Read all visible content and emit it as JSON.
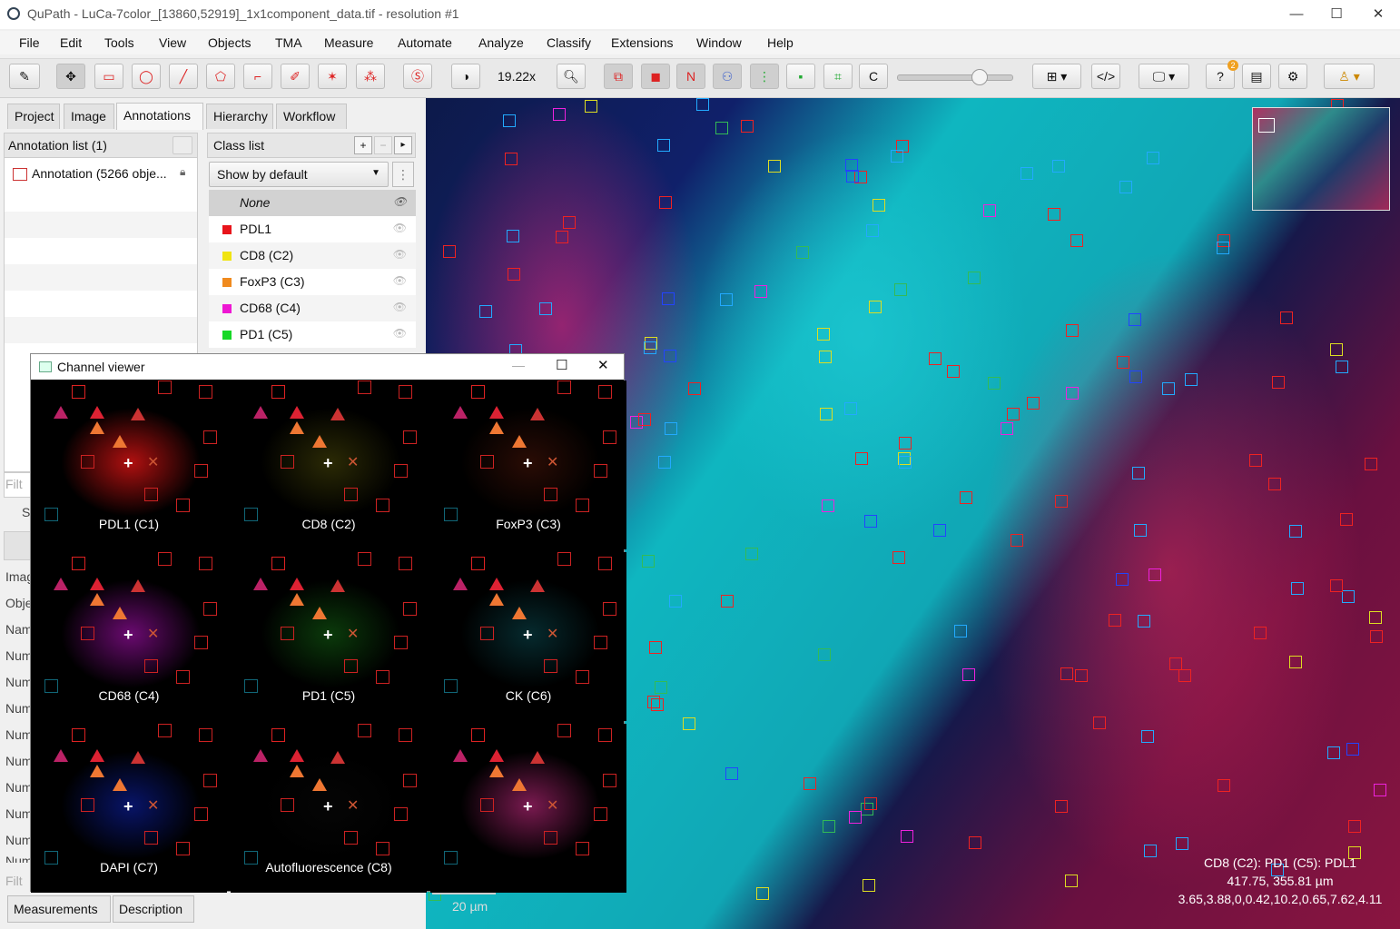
{
  "window": {
    "title": "QuPath - LuCa-7color_[13860,52919]_1x1component_data.tif - resolution #1",
    "controls": [
      "—",
      "☐",
      "✕"
    ]
  },
  "menu": [
    "File",
    "Edit",
    "Tools",
    "View",
    "Objects",
    "TMA",
    "Measure",
    "Automate",
    "Analyze",
    "Classify",
    "Extensions",
    "Window",
    "Help"
  ],
  "toolbar": {
    "zoom": "19.22x",
    "n_label": "N",
    "c_label": "C",
    "badge": "2"
  },
  "left_tabs": [
    "Project",
    "Image",
    "Annotations",
    "Hierarchy",
    "Workflow"
  ],
  "annotation_list": {
    "header": "Annotation list (1)",
    "items": [
      "Annotation (5266 obje..."
    ]
  },
  "class_list": {
    "header": "Class list",
    "show_by_default": "Show by default",
    "classes": [
      {
        "name": "None",
        "color": ""
      },
      {
        "name": "PDL1",
        "color": "#e8141b"
      },
      {
        "name": "CD8 (C2)",
        "color": "#f0e411"
      },
      {
        "name": "FoxP3 (C3)",
        "color": "#f08a1e"
      },
      {
        "name": "CD68 (C4)",
        "color": "#ee17d3"
      },
      {
        "name": "PD1 (C5)",
        "color": "#16d826"
      }
    ]
  },
  "left_cutoff": [
    "Filt",
    "S",
    "Imag",
    "Obje",
    "Nam",
    "Num",
    "Num",
    "Num",
    "Num",
    "Num",
    "Num",
    "Num",
    "Num",
    "Num",
    "Filt"
  ],
  "bottom_tabs": [
    "Measurements",
    "Description"
  ],
  "channel_viewer": {
    "title": "Channel viewer",
    "tiles": [
      {
        "label": "PDL1 (C1)",
        "color": "#b01010"
      },
      {
        "label": "CD8 (C2)",
        "color": "#2b2a05"
      },
      {
        "label": "FoxP3 (C3)",
        "color": "#2a0c05"
      },
      {
        "label": "CD68 (C4)",
        "color": "#6a0a70"
      },
      {
        "label": "PD1 (C5)",
        "color": "#0b3a0b"
      },
      {
        "label": "CK (C6)",
        "color": "#062a2e"
      },
      {
        "label": "DAPI (C7)",
        "color": "#081468"
      },
      {
        "label": "Autofluorescence (C8)",
        "color": "#050505"
      },
      {
        "label": "",
        "color": "#7a1a50"
      }
    ]
  },
  "viewer": {
    "scale_label": "20 µm",
    "info": {
      "class": "CD8 (C2): PD1 (C5): PDL1",
      "coords": "417.75, 355.81 µm",
      "values": "3.65,3.88,0,0.42,10.2,0.65,7.62,4.11"
    }
  }
}
